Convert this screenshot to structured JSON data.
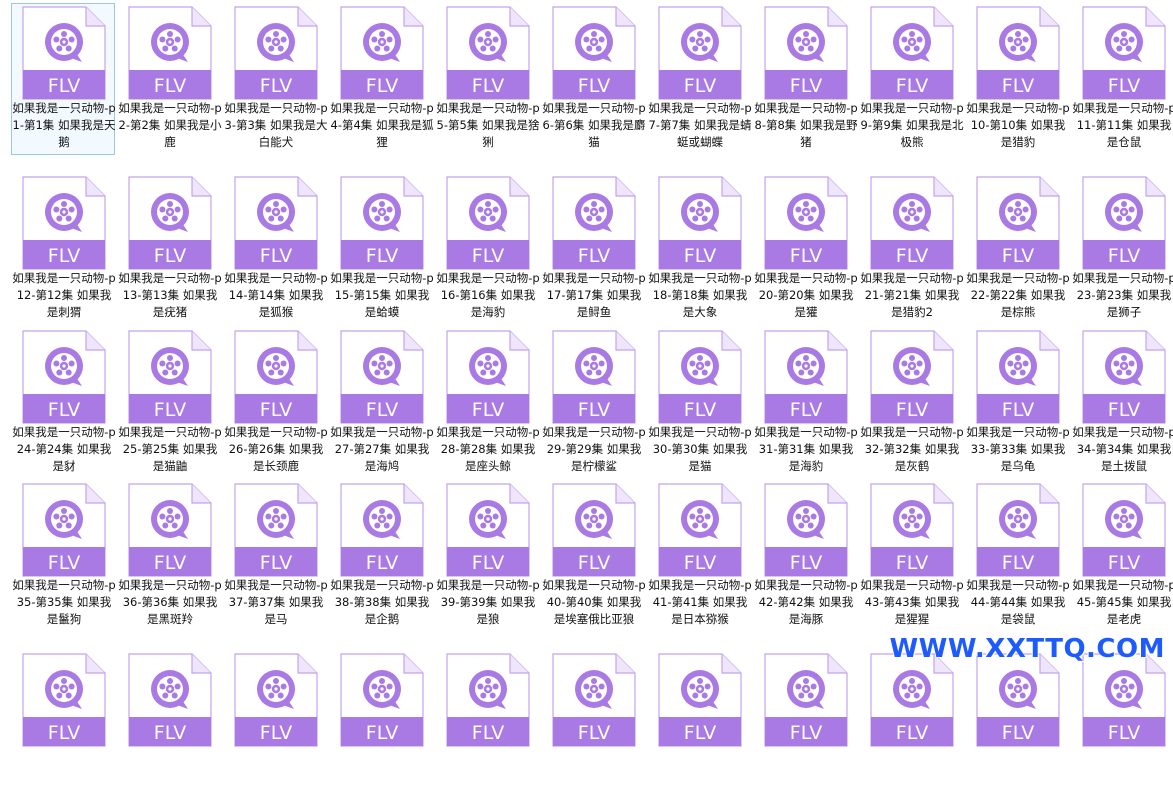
{
  "file_type_label": "FLV",
  "icon": "video-player-icon",
  "colors": {
    "icon_accent": "#a979e4",
    "icon_border": "#c3a3ee",
    "selection": "#99c7ea",
    "watermark": "#1d5bff"
  },
  "files": [
    "如果我是一只动物-p1-第1集 如果我是天鹅",
    "如果我是一只动物-p2-第2集 如果我是小鹿",
    "如果我是一只动物-p3-第3集 如果我是大白能犬",
    "如果我是一只动物-p4-第4集 如果我是狐狸",
    "如果我是一只动物-p5-第5集 如果我是猞猁",
    "如果我是一只动物-p6-第6集 如果我是麝猫",
    "如果我是一只动物-p7-第7集 如果我是蜻蜓或蝴蝶",
    "如果我是一只动物-p8-第8集 如果我是野猪",
    "如果我是一只动物-p9-第9集 如果我是北极熊",
    "如果我是一只动物-p10-第10集 如果我是猎豹",
    "如果我是一只动物-p11-第11集 如果我是仓鼠",
    "如果我是一只动物-p12-第12集 如果我是刺猬",
    "如果我是一只动物-p13-第13集 如果我是疣猪",
    "如果我是一只动物-p14-第14集 如果我是狐猴",
    "如果我是一只动物-p15-第15集 如果我是蛤蟆",
    "如果我是一只动物-p16-第16集 如果我是海豹",
    "如果我是一只动物-p17-第17集 如果我是鲟鱼",
    "如果我是一只动物-p18-第18集 如果我是大象",
    "如果我是一只动物-p20-第20集 如果我是獾",
    "如果我是一只动物-p21-第21集 如果我是猎豹2",
    "如果我是一只动物-p22-第22集 如果我是棕熊",
    "如果我是一只动物-p23-第23集 如果我是狮子",
    "如果我是一只动物-p24-第24集 如果我是豺",
    "如果我是一只动物-p25-第25集 如果我是猫鼬",
    "如果我是一只动物-p26-第26集 如果我是长颈鹿",
    "如果我是一只动物-p27-第27集 如果我是海鸠",
    "如果我是一只动物-p28-第28集 如果我是座头鲸",
    "如果我是一只动物-p29-第29集 如果我是柠檬鲨",
    "如果我是一只动物-p30-第30集 如果我是猫",
    "如果我是一只动物-p31-第31集 如果我是海豹",
    "如果我是一只动物-p32-第32集 如果我是灰鹤",
    "如果我是一只动物-p33-第33集 如果我是乌龟",
    "如果我是一只动物-p34-第34集 如果我是土拨鼠",
    "如果我是一只动物-p35-第35集 如果我是鬣狗",
    "如果我是一只动物-p36-第36集 如果我是黑斑羚",
    "如果我是一只动物-p37-第37集 如果我是马",
    "如果我是一只动物-p38-第38集 如果我是企鹅",
    "如果我是一只动物-p39-第39集 如果我是狼",
    "如果我是一只动物-p40-第40集 如果我是埃塞俄比亚狼",
    "如果我是一只动物-p41-第41集 如果我是日本猕猴",
    "如果我是一只动物-p42-第42集 如果我是海豚",
    "如果我是一只动物-p43-第43集 如果我是猩猩",
    "如果我是一只动物-p44-第44集 如果我是袋鼠",
    "如果我是一只动物-p45-第45集 如果我是老虎",
    "",
    "",
    "",
    "",
    "",
    "",
    "",
    "",
    "",
    "",
    ""
  ],
  "watermark": "WWW.XXTTQ.COM"
}
